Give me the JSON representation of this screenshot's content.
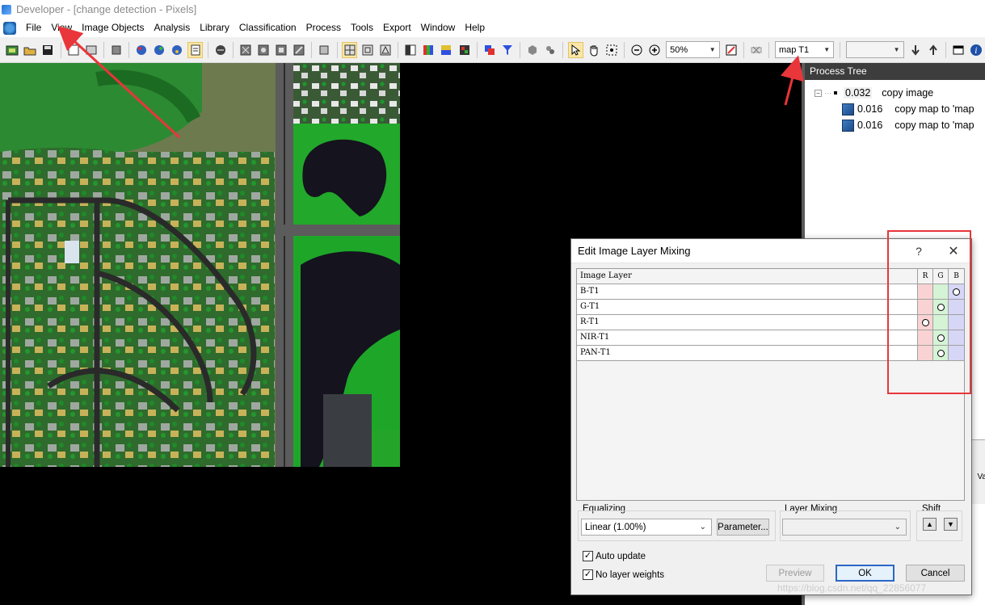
{
  "window": {
    "title": "Developer - [change detection - Pixels]"
  },
  "menu": {
    "items": [
      "File",
      "View",
      "Image Objects",
      "Analysis",
      "Library",
      "Classification",
      "Process",
      "Tools",
      "Export",
      "Window",
      "Help"
    ]
  },
  "toolbar": {
    "zoom_value": "50%",
    "map_value": "map T1",
    "empty_combo_value": ""
  },
  "process_tree": {
    "title": "Process Tree",
    "root": {
      "time": "0.032",
      "label": "copy image"
    },
    "children": [
      {
        "time": "0.016",
        "label": "copy map to 'map"
      },
      {
        "time": "0.016",
        "label": "copy map to 'map"
      }
    ],
    "strip_text": "Va"
  },
  "dialog": {
    "title": "Edit Image Layer Mixing",
    "help_label": "?",
    "close_label": "✕",
    "grid": {
      "header_name": "Image Layer",
      "header_r": "R",
      "header_g": "G",
      "header_b": "B",
      "rows": [
        {
          "name": "B-T1",
          "channel": "B"
        },
        {
          "name": "G-T1",
          "channel": "G"
        },
        {
          "name": "R-T1",
          "channel": "R"
        },
        {
          "name": "NIR-T1",
          "channel": "G"
        },
        {
          "name": "PAN-T1",
          "channel": "G"
        }
      ]
    },
    "equalizing_label": "Equalizing",
    "equalizing_value": "Linear (1.00%)",
    "parameter_button": "Parameter...",
    "layer_mixing_label": "Layer Mixing",
    "layer_mixing_value": "",
    "shift_label": "Shift",
    "auto_update_label": "Auto update",
    "auto_update_checked": true,
    "no_layer_weights_label": "No layer weights",
    "no_layer_weights_checked": true,
    "preview_button": "Preview",
    "ok_button": "OK",
    "cancel_button": "Cancel"
  },
  "watermark": "https://blog.csdn.net/qq_22856077",
  "colors": {
    "annotation_red": "#e8363a",
    "panel_title_bg": "#3d3d3d",
    "ok_border": "#2a67c5"
  }
}
